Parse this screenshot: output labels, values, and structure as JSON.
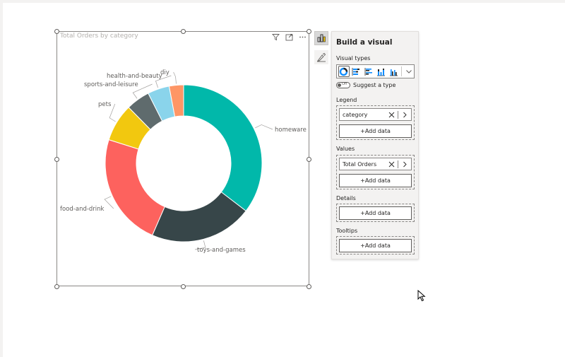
{
  "visual": {
    "title": "Total Orders by category"
  },
  "pane": {
    "title": "Build a visual",
    "visual_types_label": "Visual types",
    "visual_types": [
      "donut-chart-icon",
      "stacked-bar-chart-icon",
      "clustered-bar-chart-icon",
      "stacked-column-chart-icon",
      "clustered-column-chart-icon"
    ],
    "suggest_toggle_state": "Off",
    "suggest_label": "Suggest a type",
    "legend_label": "Legend",
    "legend_field": "category",
    "values_label": "Values",
    "values_field": "Total Orders",
    "details_label": "Details",
    "tooltips_label": "Tooltips",
    "add_data_label": "+Add data"
  },
  "chart_data": {
    "type": "pie",
    "title": "Total Orders by category",
    "categories": [
      "homeware",
      "toys-and-games",
      "food-and-drink",
      "pets",
      "sports-and-leisure",
      "health-and-beauty",
      "diy"
    ],
    "values": [
      34.6,
      20.7,
      22.8,
      7.6,
      4.8,
      4.4,
      2.9
    ],
    "colors": [
      "#01B8AA",
      "#374649",
      "#FD625E",
      "#F2C80F",
      "#5F6B6D",
      "#8AD4EB",
      "#FE9666"
    ],
    "legend": "none",
    "data_labels": "outside"
  }
}
